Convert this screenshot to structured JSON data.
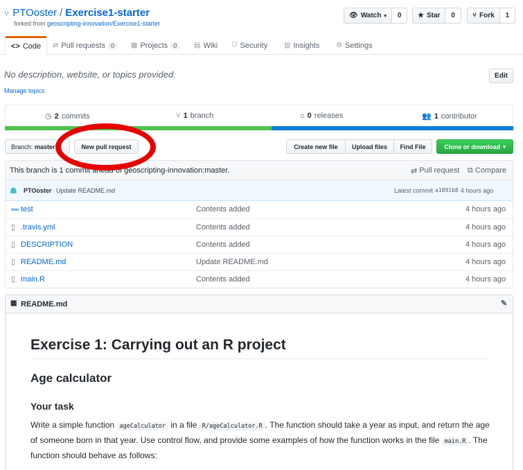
{
  "repo": {
    "owner": "PTOoster",
    "separator": "/",
    "name": "Exercise1-starter",
    "forked_prefix": "forked from",
    "forked_from": "geoscripting-innovation/Exercise1-starter"
  },
  "actions": {
    "watch_label": "Watch",
    "watch_count": "0",
    "star_label": "Star",
    "star_count": "0",
    "fork_label": "Fork",
    "fork_count": "1"
  },
  "tabs": [
    {
      "label": "Code",
      "count": ""
    },
    {
      "label": "Pull requests",
      "count": "0"
    },
    {
      "label": "Projects",
      "count": "0"
    },
    {
      "label": "Wiki",
      "count": ""
    },
    {
      "label": "Security",
      "count": ""
    },
    {
      "label": "Insights",
      "count": ""
    },
    {
      "label": "Settings",
      "count": ""
    }
  ],
  "description": "No description, website, or topics provided.",
  "manage_topics": "Manage topics",
  "edit_label": "Edit",
  "summary": {
    "commits_num": "2",
    "commits_label": "commits",
    "branch_num": "1",
    "branch_label": "branch",
    "releases_num": "0",
    "releases_label": "releases",
    "contributor_num": "1",
    "contributor_label": "contributor"
  },
  "languages": [
    {
      "color": "#4ec24e",
      "percent": 52.5
    },
    {
      "color": "#0b7fd8",
      "percent": 47.5
    }
  ],
  "toolbar": {
    "branch_label": "Branch:",
    "branch_value": "master",
    "new_pr": "New pull request",
    "create_file": "Create new file",
    "upload_files": "Upload files",
    "find_file": "Find File",
    "clone": "Clone or download"
  },
  "behind_text": "This branch is 1 commit ahead of geoscripting-innovation:master.",
  "pull_request_link": "Pull request",
  "compare_link": "Compare",
  "latest_commit": {
    "author": "PTOoster",
    "message": "Update README.md",
    "prefix": "Latest commit",
    "sha": "a1091b8",
    "time": "4 hours ago"
  },
  "files": [
    {
      "name": "test",
      "kind": "dir",
      "message": "Contents added",
      "age": "4 hours ago"
    },
    {
      "name": ".travis.yml",
      "kind": "file",
      "message": "Contents added",
      "age": "4 hours ago"
    },
    {
      "name": "DESCRIPTION",
      "kind": "file",
      "message": "Contents added",
      "age": "4 hours ago"
    },
    {
      "name": "README.md",
      "kind": "file",
      "message": "Update README.md",
      "age": "4 hours ago"
    },
    {
      "name": "main.R",
      "kind": "file",
      "message": "Contents added",
      "age": "4 hours ago"
    }
  ],
  "readme": {
    "filename": "README.md",
    "h1": "Exercise 1: Carrying out an R project",
    "h2": "Age calculator",
    "h3": "Your task",
    "p1": "Write a simple function",
    "c1": "ageCalculator",
    "p2": "in a file",
    "c2": "R/ageCalculator.R",
    "p3": ". The function should take a year as input, and return the age of someone born in that year. Use control flow, and provide some examples of how the function works in the file",
    "c3": "main.R",
    "p4": ". The function should behave as follows:"
  }
}
